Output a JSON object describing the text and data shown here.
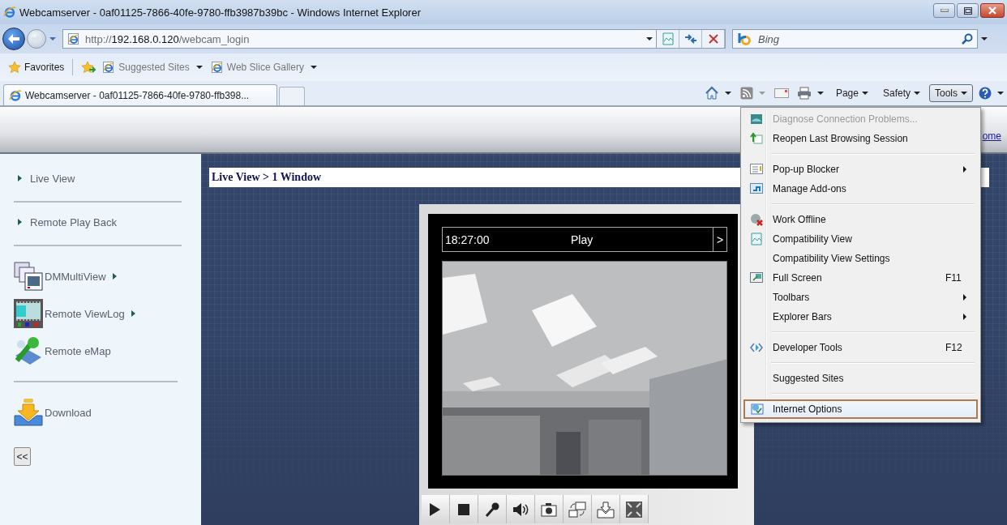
{
  "window": {
    "title": "Webcamserver - 0af01125-7866-40fe-9780-ffb3987b39bc - Windows Internet Explorer"
  },
  "address_bar": {
    "scheme": "http://",
    "host": "192.168.0.120",
    "path": "/webcam_login"
  },
  "search": {
    "placeholder": "Bing"
  },
  "favorites_bar": {
    "favorites": "Favorites",
    "links": [
      {
        "label": "Suggested Sites"
      },
      {
        "label": "Web Slice Gallery"
      }
    ]
  },
  "tabs": [
    {
      "label": "Webcamserver - 0af01125-7866-40fe-9780-ffb398...",
      "selected": true
    }
  ],
  "command_bar": [
    {
      "label": "Page",
      "selected": false
    },
    {
      "label": "Safety",
      "selected": false
    },
    {
      "label": "Tools",
      "selected": true
    }
  ],
  "page": {
    "header_link": "ome",
    "sidebar": {
      "items": [
        {
          "label": "Live View",
          "kind": "bullet",
          "submenu": false,
          "divider_after": true
        },
        {
          "label": "Remote Play Back",
          "kind": "bullet",
          "submenu": false,
          "divider_after": true
        },
        {
          "label": "DMMultiView",
          "kind": "icon",
          "submenu": true,
          "divider_after": false
        },
        {
          "label": "Remote ViewLog",
          "kind": "icon",
          "submenu": true,
          "divider_after": false
        },
        {
          "label": "Remote eMap",
          "kind": "icon",
          "submenu": false,
          "divider_after": true
        },
        {
          "label": "Download",
          "kind": "icon",
          "submenu": false,
          "divider_after": false
        }
      ],
      "collapse_button": "<<"
    },
    "breadcrumb": "Live View > 1 Window",
    "player": {
      "time": "18:27:00",
      "status": "Play",
      "next_button": ">"
    }
  },
  "tools_menu": {
    "groups": [
      {
        "items": [
          {
            "label": "Diagnose Connection Problems...",
            "disabled": true,
            "submenu": false,
            "selected": false
          },
          {
            "label": "Reopen Last Browsing Session",
            "disabled": false,
            "submenu": false,
            "selected": false
          }
        ]
      },
      {
        "items": [
          {
            "label": "Pop-up Blocker",
            "disabled": false,
            "submenu": true,
            "selected": false
          },
          {
            "label": "Manage Add-ons",
            "disabled": false,
            "submenu": false,
            "selected": false
          }
        ]
      },
      {
        "items": [
          {
            "label": "Work Offline",
            "disabled": false,
            "submenu": false,
            "selected": false
          },
          {
            "label": "Compatibility View",
            "disabled": false,
            "submenu": false,
            "selected": false
          },
          {
            "label": "Compatibility View Settings",
            "disabled": false,
            "submenu": false,
            "selected": false
          },
          {
            "label": "Full Screen",
            "shortcut": "F11",
            "disabled": false,
            "submenu": false,
            "selected": false
          },
          {
            "label": "Toolbars",
            "disabled": false,
            "submenu": true,
            "selected": false
          },
          {
            "label": "Explorer Bars",
            "disabled": false,
            "submenu": true,
            "selected": false
          }
        ]
      },
      {
        "items": [
          {
            "label": "Developer Tools",
            "shortcut": "F12",
            "disabled": false,
            "submenu": false,
            "selected": false
          }
        ]
      },
      {
        "items": [
          {
            "label": "Suggested Sites",
            "disabled": false,
            "submenu": false,
            "selected": false
          }
        ]
      },
      {
        "items": [
          {
            "label": "Internet Options",
            "disabled": false,
            "submenu": false,
            "selected": true
          }
        ]
      }
    ]
  }
}
